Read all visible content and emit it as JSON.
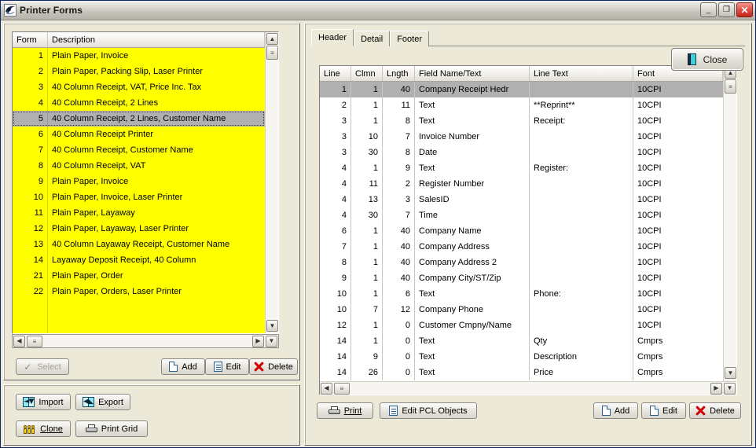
{
  "window": {
    "title": "Printer Forms",
    "icon": "printer-swoosh-icon",
    "minimize_label": "_",
    "maximize_label": "❐",
    "close_label": "✕"
  },
  "close_button": {
    "label": "Close",
    "icon": "exit-door-icon"
  },
  "left_panel": {
    "grid": {
      "columns": [
        "Form",
        "Description"
      ],
      "rows": [
        {
          "form": "1",
          "description": "Plain Paper, Invoice",
          "selected": false
        },
        {
          "form": "2",
          "description": "Plain Paper, Packing Slip, Laser Printer",
          "selected": false
        },
        {
          "form": "3",
          "description": "40 Column Receipt, VAT, Price Inc. Tax",
          "selected": false
        },
        {
          "form": "4",
          "description": "40 Column Receipt, 2 Lines",
          "selected": false
        },
        {
          "form": "5",
          "description": "40 Column Receipt, 2 Lines, Customer Name",
          "selected": true
        },
        {
          "form": "6",
          "description": "40 Column Receipt Printer",
          "selected": false
        },
        {
          "form": "7",
          "description": "40 Column Receipt, Customer Name",
          "selected": false
        },
        {
          "form": "8",
          "description": "40 Column Receipt, VAT",
          "selected": false
        },
        {
          "form": "9",
          "description": "Plain Paper, Invoice",
          "selected": false
        },
        {
          "form": "10",
          "description": "Plain Paper, Invoice, Laser Printer",
          "selected": false
        },
        {
          "form": "11",
          "description": "Plain Paper, Layaway",
          "selected": false
        },
        {
          "form": "12",
          "description": "Plain Paper, Layaway, Laser Printer",
          "selected": false
        },
        {
          "form": "13",
          "description": "40 Column Layaway Receipt, Customer Name",
          "selected": false
        },
        {
          "form": "14",
          "description": "Layaway Deposit Receipt, 40 Column",
          "selected": false
        },
        {
          "form": "21",
          "description": "Plain Paper, Order",
          "selected": false
        },
        {
          "form": "22",
          "description": "Plain Paper, Orders, Laser Printer",
          "selected": false
        }
      ]
    },
    "buttons": {
      "select": {
        "label": "Select",
        "icon": "check-icon",
        "disabled": true
      },
      "add": {
        "label": "Add",
        "icon": "new-page-icon"
      },
      "edit": {
        "label": "Edit",
        "icon": "edit-page-icon"
      },
      "delete": {
        "label": "Delete",
        "icon": "red-x-icon"
      }
    },
    "tools": {
      "import": {
        "label": "Import",
        "icon": "import-icon"
      },
      "export": {
        "label": "Export",
        "icon": "export-icon"
      },
      "clone": {
        "label": "Clone",
        "icon": "people-icon"
      },
      "print_grid": {
        "label": "Print Grid",
        "icon": "printer-icon"
      }
    }
  },
  "right_panel": {
    "tabs": [
      {
        "label": "Header",
        "active": true
      },
      {
        "label": "Detail",
        "active": false
      },
      {
        "label": "Footer",
        "active": false
      }
    ],
    "grid": {
      "columns": [
        "Line",
        "Clmn",
        "Lngth",
        "Field Name/Text",
        "Line Text",
        "Font"
      ],
      "rows": [
        {
          "line": "1",
          "clmn": "1",
          "lngth": "40",
          "field": "Company Receipt Hedr",
          "text": "",
          "font": "10CPI",
          "selected": true
        },
        {
          "line": "2",
          "clmn": "1",
          "lngth": "11",
          "field": "Text",
          "text": "**Reprint**",
          "font": "10CPI",
          "selected": false
        },
        {
          "line": "3",
          "clmn": "1",
          "lngth": "8",
          "field": "Text",
          "text": "Receipt:",
          "font": "10CPI",
          "selected": false
        },
        {
          "line": "3",
          "clmn": "10",
          "lngth": "7",
          "field": "Invoice Number",
          "text": "",
          "font": "10CPI",
          "selected": false
        },
        {
          "line": "3",
          "clmn": "30",
          "lngth": "8",
          "field": "Date",
          "text": "",
          "font": "10CPI",
          "selected": false
        },
        {
          "line": "4",
          "clmn": "1",
          "lngth": "9",
          "field": "Text",
          "text": "Register:",
          "font": "10CPI",
          "selected": false
        },
        {
          "line": "4",
          "clmn": "11",
          "lngth": "2",
          "field": "Register Number",
          "text": "",
          "font": "10CPI",
          "selected": false
        },
        {
          "line": "4",
          "clmn": "13",
          "lngth": "3",
          "field": "SalesID",
          "text": "",
          "font": "10CPI",
          "selected": false
        },
        {
          "line": "4",
          "clmn": "30",
          "lngth": "7",
          "field": "Time",
          "text": "",
          "font": "10CPI",
          "selected": false
        },
        {
          "line": "6",
          "clmn": "1",
          "lngth": "40",
          "field": "Company Name",
          "text": "",
          "font": "10CPI",
          "selected": false
        },
        {
          "line": "7",
          "clmn": "1",
          "lngth": "40",
          "field": "Company Address",
          "text": "",
          "font": "10CPI",
          "selected": false
        },
        {
          "line": "8",
          "clmn": "1",
          "lngth": "40",
          "field": "Company Address 2",
          "text": "",
          "font": "10CPI",
          "selected": false
        },
        {
          "line": "9",
          "clmn": "1",
          "lngth": "40",
          "field": "Company City/ST/Zip",
          "text": "",
          "font": "10CPI",
          "selected": false
        },
        {
          "line": "10",
          "clmn": "1",
          "lngth": "6",
          "field": "Text",
          "text": "Phone:",
          "font": "10CPI",
          "selected": false
        },
        {
          "line": "10",
          "clmn": "7",
          "lngth": "12",
          "field": "Company Phone",
          "text": "",
          "font": "10CPI",
          "selected": false
        },
        {
          "line": "12",
          "clmn": "1",
          "lngth": "0",
          "field": "Customer Cmpny/Name",
          "text": "",
          "font": "10CPI",
          "selected": false
        },
        {
          "line": "14",
          "clmn": "1",
          "lngth": "0",
          "field": "Text",
          "text": "Qty",
          "font": "Cmprs",
          "selected": false
        },
        {
          "line": "14",
          "clmn": "9",
          "lngth": "0",
          "field": "Text",
          "text": "Description",
          "font": "Cmprs",
          "selected": false
        },
        {
          "line": "14",
          "clmn": "26",
          "lngth": "0",
          "field": "Text",
          "text": "Price",
          "font": "Cmprs",
          "selected": false
        }
      ]
    },
    "buttons": {
      "print": {
        "label": "Print",
        "icon": "printer-icon"
      },
      "edit_pcl": {
        "label": "Edit PCL Objects",
        "icon": "edit-page-icon"
      },
      "add": {
        "label": "Add",
        "icon": "new-page-icon"
      },
      "edit": {
        "label": "Edit",
        "icon": "new-page-icon"
      },
      "delete": {
        "label": "Delete",
        "icon": "red-x-icon"
      }
    }
  },
  "scrollbars": {
    "up_arrow": "▲",
    "down_arrow": "▼",
    "left_arrow": "◀",
    "right_arrow": "▶",
    "thumb_grip": "≡"
  },
  "colors": {
    "highlight_yellow": "#ffff00",
    "selection_gray": "#b0b0b0",
    "window_face": "#ece9d8",
    "titlebar_border": "#0a246a",
    "close_red": "#c0271d"
  }
}
